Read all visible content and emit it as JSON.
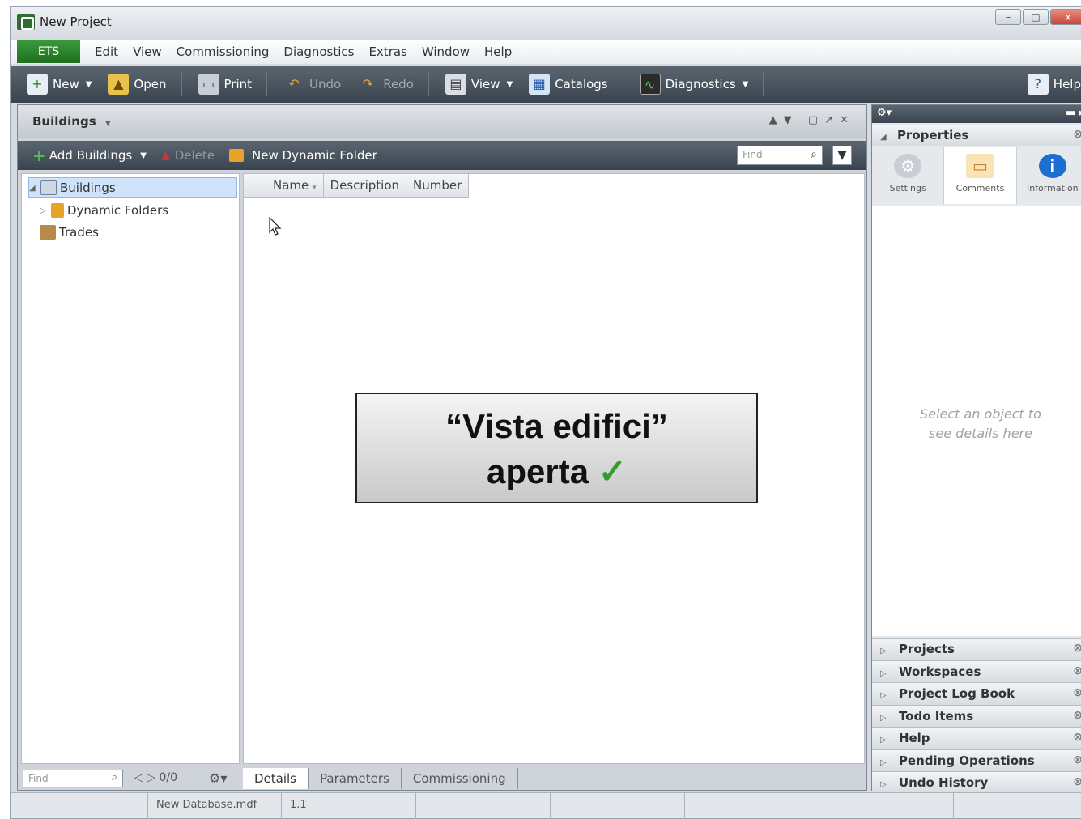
{
  "window": {
    "title": "New Project",
    "buttons": [
      "–",
      "□",
      "x"
    ]
  },
  "menu": {
    "ets": "ETS",
    "items": [
      "Edit",
      "View",
      "Commissioning",
      "Diagnostics",
      "Extras",
      "Window",
      "Help"
    ]
  },
  "toolbar": {
    "new": "New",
    "open": "Open",
    "print": "Print",
    "undo": "Undo",
    "redo": "Redo",
    "view": "View",
    "catalogs": "Catalogs",
    "diagnostics": "Diagnostics",
    "help": "Help"
  },
  "buildings_pane": {
    "title": "Buildings",
    "add_buildings": "Add Buildings",
    "delete": "Delete",
    "new_dynamic_folder": "New Dynamic Folder",
    "find_placeholder": "Find",
    "tree": [
      "Buildings",
      "Dynamic Folders",
      "Trades"
    ],
    "columns": [
      "Name",
      "Description",
      "Number"
    ],
    "bottom_find_placeholder": "Find",
    "pager": "0/0",
    "tabs": [
      "Details",
      "Parameters",
      "Commissioning"
    ]
  },
  "properties": {
    "title": "Properties",
    "tabs": [
      "Settings",
      "Comments",
      "Information"
    ],
    "hint_line1": "Select an object to",
    "hint_line2": "see details here",
    "sections": [
      "Projects",
      "Workspaces",
      "Project Log Book",
      "Todo Items",
      "Help",
      "Pending Operations",
      "Undo History"
    ]
  },
  "statusbar": {
    "database": "New Database.mdf",
    "version": "1.1"
  },
  "callout": {
    "line1": "“Vista edifici”",
    "line2": "aperta",
    "check": "✓"
  },
  "colors": {
    "ets_green": "#2f8a2f",
    "toolbar_dark": "#3a444e",
    "check_green": "#2f9e2f"
  }
}
